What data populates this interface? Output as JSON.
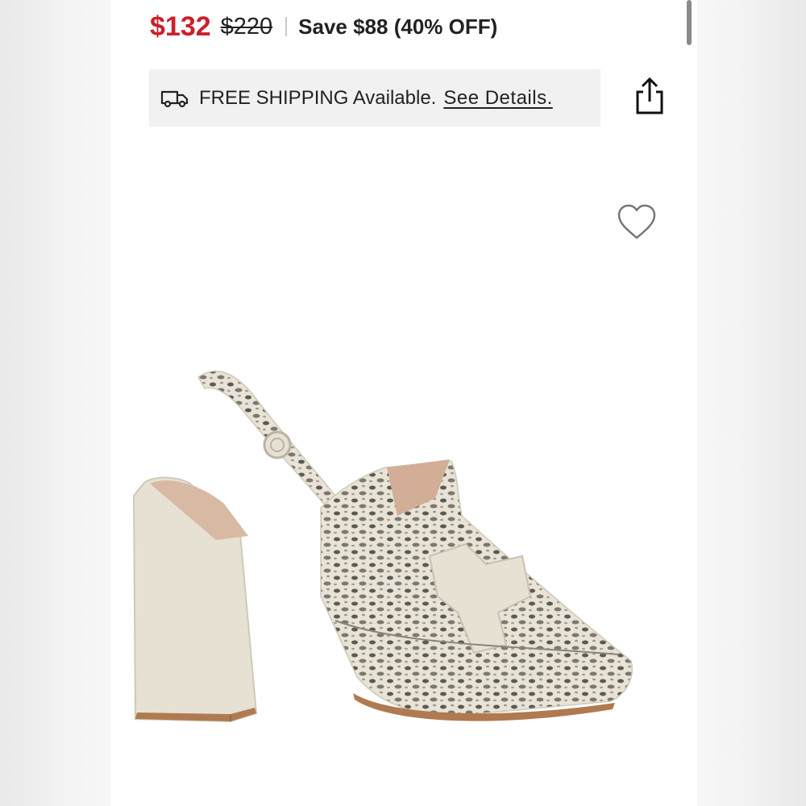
{
  "product": {
    "image_alt": "Snake print slingback loafer pump with block heel"
  },
  "pricing": {
    "sale_price": "$132",
    "original_price": "$220",
    "savings_text": "Save $88 (40% OFF)"
  },
  "shipping": {
    "message": "FREE SHIPPING Available.",
    "details_link": "See Details."
  },
  "icons": {
    "truck": "truck-icon",
    "share": "share-icon",
    "heart": "heart-icon"
  },
  "colors": {
    "sale_red": "#cc1f2c",
    "banner_bg": "#f1f1f1",
    "text": "#222222"
  }
}
